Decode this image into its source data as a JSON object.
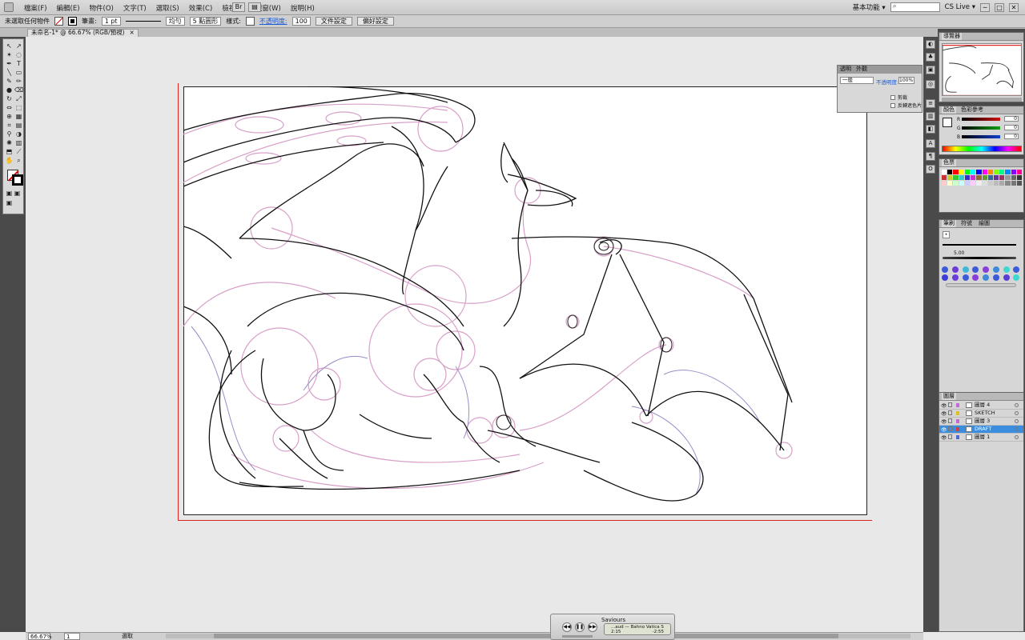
{
  "menubar": {
    "menus": [
      "檔案(F)",
      "編輯(E)",
      "物件(O)",
      "文字(T)",
      "選取(S)",
      "效果(C)",
      "檢視(V)",
      "視窗(W)",
      "說明(H)"
    ],
    "tool_btns": [
      "Br",
      "▤"
    ],
    "workspace": "基本功能 ▾",
    "search_placeholder": "",
    "cs_live": "CS Live ▾",
    "window_buttons": [
      "─",
      "□",
      "✕"
    ]
  },
  "control_bar": {
    "selection_label": "未選取任何物件",
    "stroke_label": "筆畫:",
    "stroke_weight": "1 pt",
    "brush_label": "均勻",
    "basic_label": "5 點圓形",
    "style_label": "樣式:",
    "opacity_label": "不透明度:",
    "opacity_value": "100",
    "doc_setup_button": "文件設定",
    "prefs_button": "偏好設定"
  },
  "doc_tab": {
    "title": "未命名-1* @ 66.67% (RGB/預視)",
    "close": "×"
  },
  "float_panel": {
    "tabs": [
      "透明",
      "外觀"
    ],
    "blend_mode": "一般",
    "opacity_label": "不透明度:",
    "opacity_value": "100",
    "opacity_unit": "%",
    "check1": "剪裁",
    "check2": "反轉遮色片"
  },
  "right_dock": {
    "navigator_tabs": [
      "導覽器"
    ],
    "color_tabs": [
      "顏色",
      "色彩參考"
    ],
    "color": {
      "labels": [
        "R",
        "G",
        "B"
      ],
      "values": [
        "0",
        "0",
        "0"
      ],
      "colors": [
        "#d01010",
        "#10a010",
        "#1040d0"
      ]
    },
    "swatches_tabs": [
      "色票"
    ],
    "brushes_tabs": [
      "筆刷",
      "符號",
      "繪圖"
    ],
    "brush_size_label": "5.00",
    "layers_tabs": [
      "圖層"
    ],
    "layers": [
      {
        "name": "圖層 4",
        "color": "#c06ad8",
        "selected": false
      },
      {
        "name": "SKETCH",
        "color": "#e0c020",
        "selected": false
      },
      {
        "name": "圖層 3",
        "color": "#c06ad8",
        "selected": false
      },
      {
        "name": "DRAFT",
        "color": "#d04040",
        "selected": true
      },
      {
        "name": "圖層 1",
        "color": "#4a6ad8",
        "selected": false
      }
    ]
  },
  "statusbar": {
    "zoom": "66.67%",
    "page": "1",
    "tool": "選取"
  },
  "player": {
    "title": "Saviours",
    "track": "...aud — Bahno Vatica Slo",
    "elapsed": "2:15",
    "remaining": "-2:55",
    "buttons": [
      "◀◀",
      "❚❚",
      "▶▶"
    ]
  }
}
